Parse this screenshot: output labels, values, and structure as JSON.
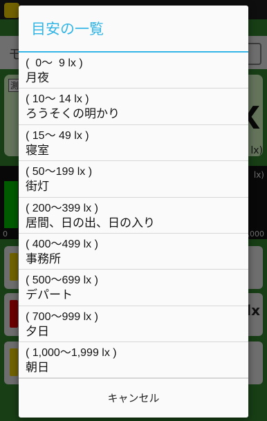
{
  "background": {
    "field_text": "モ",
    "panel_tag": "測",
    "big_value": "x",
    "unit": "lx)",
    "graph_unit": "lx)",
    "graph_zero": "0",
    "graph_max": ",000",
    "row_unit": "lx"
  },
  "dialog": {
    "title": "目安の一覧",
    "items": [
      {
        "range": "(  0〜  9 lx )",
        "label": "月夜"
      },
      {
        "range": "( 10〜 14 lx )",
        "label": "ろうそくの明かり"
      },
      {
        "range": "( 15〜 49 lx )",
        "label": "寝室"
      },
      {
        "range": "( 50〜199 lx )",
        "label": "街灯"
      },
      {
        "range": "( 200〜399 lx )",
        "label": "居間、日の出、日の入り"
      },
      {
        "range": "( 400〜499 lx )",
        "label": "事務所"
      },
      {
        "range": "( 500〜699 lx )",
        "label": "デパート"
      },
      {
        "range": "( 700〜999 lx )",
        "label": "夕日"
      },
      {
        "range": "( 1,000〜1,999 lx )",
        "label": "朝日"
      }
    ],
    "cancel_label": "キャンセル"
  },
  "colors": {
    "accent": "#33b5e5"
  }
}
